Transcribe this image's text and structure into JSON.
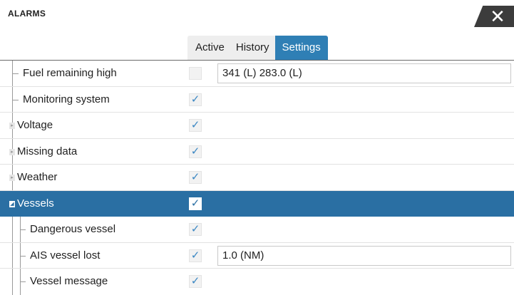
{
  "dialog": {
    "title": "ALARMS",
    "close_label": "✕"
  },
  "tabs": [
    {
      "label": "Active",
      "selected": false
    },
    {
      "label": "History",
      "selected": false
    },
    {
      "label": "Settings",
      "selected": true
    }
  ],
  "rows": [
    {
      "label": "Fuel remaining high",
      "checked": false,
      "value": "341 (L) 283.0 (L)"
    },
    {
      "label": "Monitoring system",
      "checked": true
    },
    {
      "label": "Voltage",
      "checked": true,
      "expander": "▸"
    },
    {
      "label": "Missing data",
      "checked": true,
      "expander": "▸"
    },
    {
      "label": "Weather",
      "checked": true,
      "expander": "▸"
    },
    {
      "label": "Vessels",
      "checked": true,
      "expander": "◢",
      "selected": true
    },
    {
      "label": "Dangerous vessel",
      "checked": true
    },
    {
      "label": "AIS vessel lost",
      "checked": true,
      "value": "1.0 (NM)"
    },
    {
      "label": "Vessel message",
      "checked": true
    }
  ],
  "check_glyph": "✓",
  "colors": {
    "accent": "#2f7fb5",
    "selected_row": "#2a6fa3",
    "close_button": "#3c3c3c",
    "check": "#3a87c3"
  }
}
